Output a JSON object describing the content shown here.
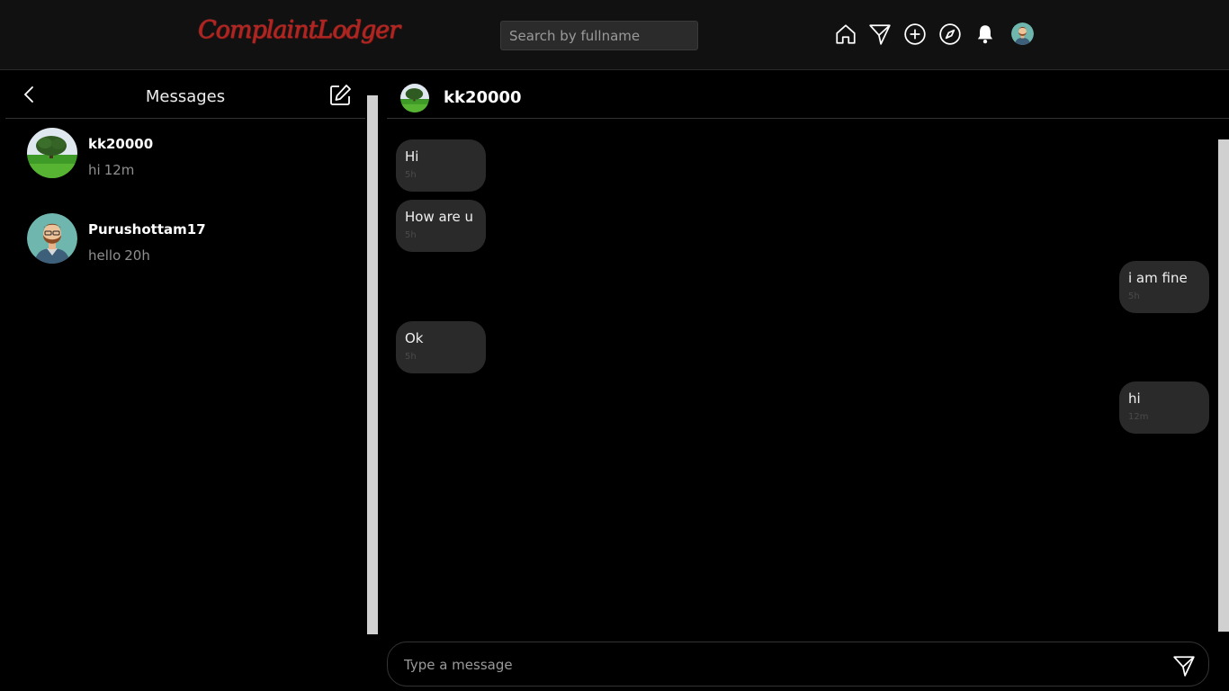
{
  "app": {
    "logo_text": "ComplaintLodger"
  },
  "search": {
    "placeholder": "Search by fullname",
    "value": ""
  },
  "nav": {
    "icons": [
      "home-icon",
      "paper-plane-icon",
      "plus-circle-icon",
      "compass-icon",
      "bell-icon",
      "profile-avatar"
    ]
  },
  "inbox": {
    "title": "Messages",
    "conversations": [
      {
        "name": "kk20000",
        "last_message": "hi",
        "time": "12m",
        "avatar": "tree-landscape"
      },
      {
        "name": "Purushottam17",
        "last_message": "hello",
        "time": "20h",
        "avatar": "bearded-man"
      }
    ]
  },
  "chat": {
    "contact_name": "kk20000",
    "messages": [
      {
        "text": "Hi",
        "time": "5h",
        "side": "incoming"
      },
      {
        "text": "How are u",
        "time": "5h",
        "side": "incoming"
      },
      {
        "text": "i am fine",
        "time": "5h",
        "side": "outgoing"
      },
      {
        "text": "Ok",
        "time": "5h",
        "side": "incoming"
      },
      {
        "text": "hi",
        "time": "12m",
        "side": "outgoing"
      }
    ],
    "composer_placeholder": "Type a message"
  },
  "colors": {
    "background": "#000000",
    "topbar": "#111111",
    "bubble": "#2a2a2a",
    "logo": "#b3221f"
  }
}
